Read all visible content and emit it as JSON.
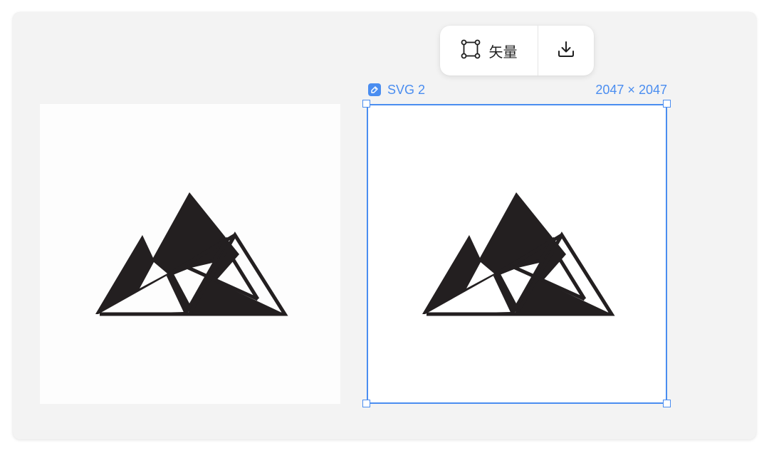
{
  "toolbar": {
    "vector_label": "矢量",
    "vector_icon": "vector-path-icon",
    "download_icon": "download-icon"
  },
  "selected_frame": {
    "name": "SVG 2",
    "dimensions": "2047 × 2047",
    "icon": "frame-badge-icon"
  },
  "colors": {
    "canvas": "#f3f3f3",
    "selection": "#4a8df0",
    "logo": "#231f20"
  },
  "images": [
    {
      "name": "source-image",
      "depicts": "mountain-logo"
    },
    {
      "name": "svg-image",
      "depicts": "mountain-logo"
    }
  ]
}
